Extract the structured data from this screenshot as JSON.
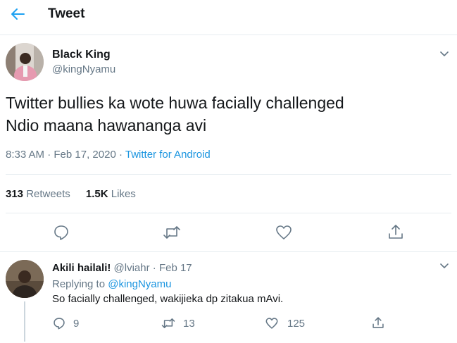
{
  "header": {
    "title": "Tweet",
    "back_icon": "arrow-left-icon"
  },
  "tweet": {
    "author_name": "Black King",
    "author_handle": "@kingNyamu",
    "text_line1": "Twitter bullies ka wote huwa facially challenged",
    "text_line2": "Ndio maana hawananga avi",
    "time": "8:33 AM",
    "sep1": "·",
    "date": "Feb 17, 2020",
    "sep2": "·",
    "source": "Twitter for Android",
    "retweets_count": "313",
    "retweets_label": "Retweets",
    "likes_count": "1.5K",
    "likes_label": "Likes"
  },
  "reply": {
    "author_name": "Akili hailali!",
    "author_handle": "@lviahr",
    "sep": "·",
    "date": "Feb 17",
    "replying_label": "Replying to",
    "replying_handle": "@kingNyamu",
    "text": "So facially challenged, wakijieka dp zitakua mAvi.",
    "reply_count": "9",
    "retweet_count": "13",
    "like_count": "125"
  },
  "colors": {
    "accent": "#1da1f2",
    "link": "#1b95e0",
    "muted": "#657786",
    "divider": "#e6ecf0"
  }
}
